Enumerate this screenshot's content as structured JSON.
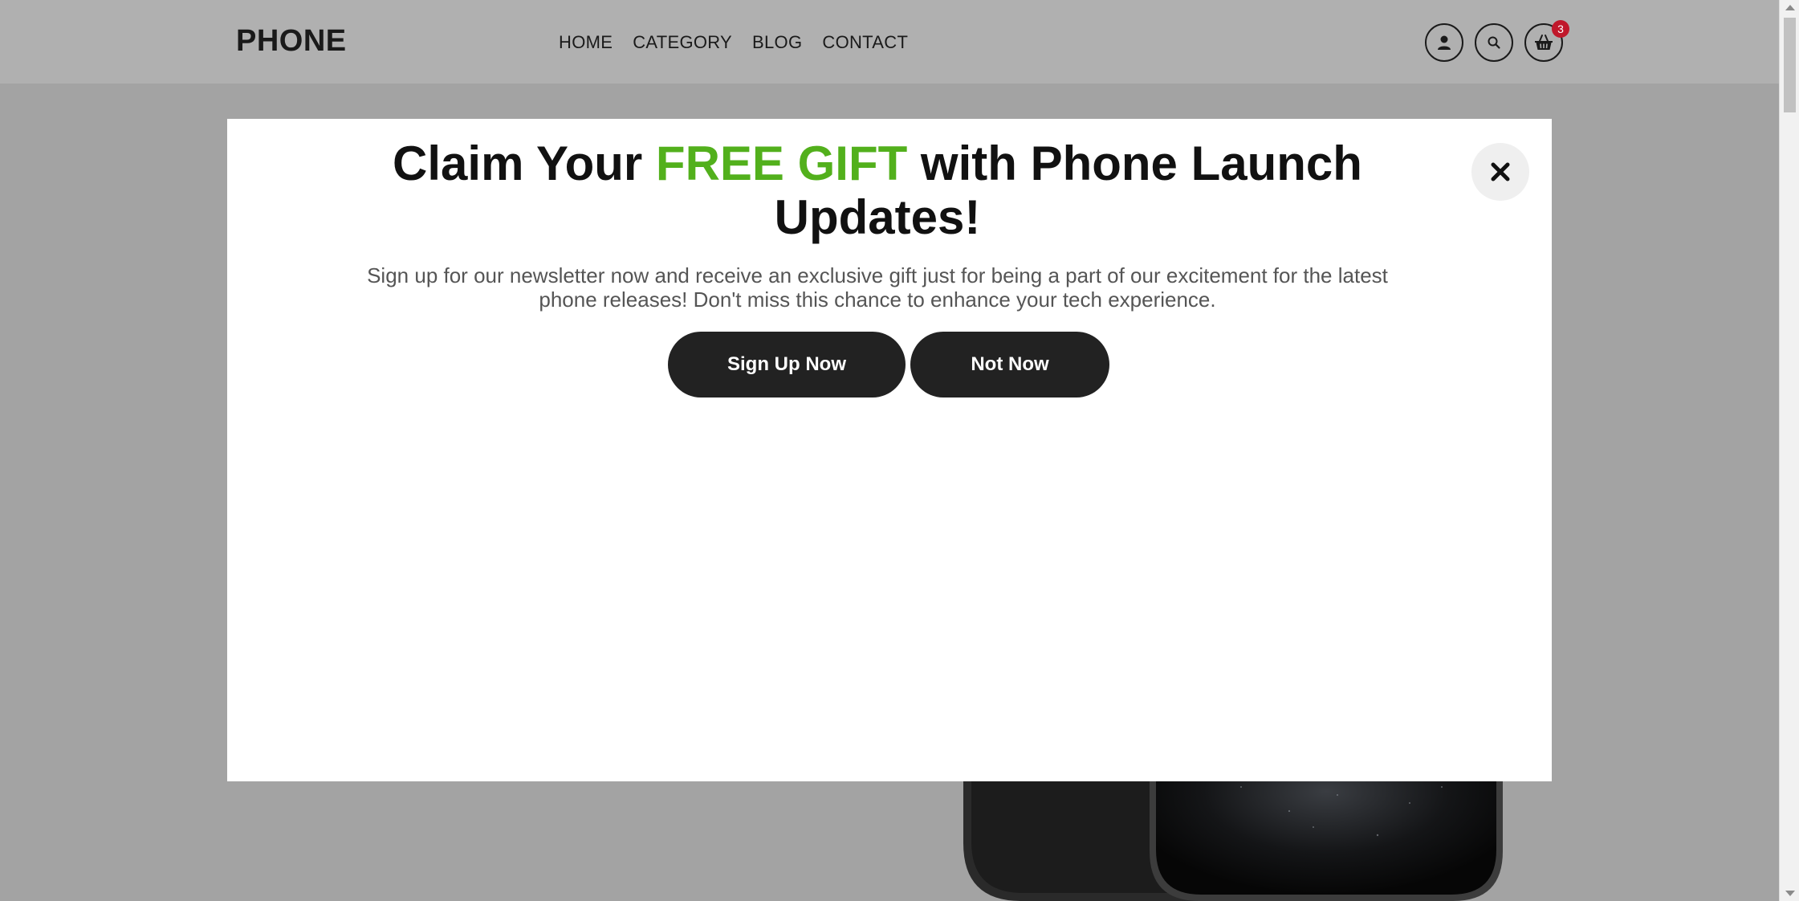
{
  "header": {
    "logo": "PHONE",
    "nav": [
      "HOME",
      "CATEGORY",
      "BLOG",
      "CONTACT"
    ],
    "icons": [
      "user-icon",
      "search-icon",
      "basket-icon"
    ],
    "cart_count": "3"
  },
  "modal": {
    "title_part1": "Claim Your ",
    "title_accent": "FREE GIFT",
    "title_part2": " with Phone Launch Updates!",
    "description": "Sign up for our newsletter now and receive an exclusive gift just for being a part of our excitement for the latest phone releases! Don't miss this chance to enhance your tech experience.",
    "primary_button": "Sign Up Now",
    "secondary_button": "Not Now",
    "close_icon": "close-icon"
  },
  "colors": {
    "accent": "#52b01c",
    "button": "#222222",
    "badge": "#c0182b",
    "overlay": "#a3a3a3"
  }
}
